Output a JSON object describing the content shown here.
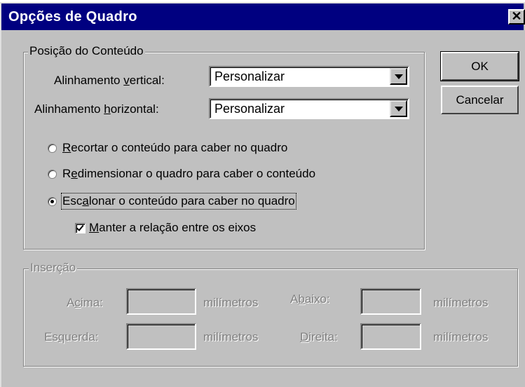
{
  "window": {
    "title": "Opções de Quadro",
    "close_glyph": "✕"
  },
  "content_position": {
    "group_title": "Posição do Conteúdo",
    "vertical_align": {
      "label_pre": "Alinhamento ",
      "label_ul": "v",
      "label_post": "ertical:",
      "value": "Personalizar"
    },
    "horizontal_align": {
      "label_pre": "Alinhamento ",
      "label_ul": "h",
      "label_post": "orizontal:",
      "value": "Personalizar"
    },
    "options": [
      {
        "ul": "R",
        "text": "ecortar o conteúdo para caber no quadro",
        "selected": false
      },
      {
        "pre": "R",
        "ul": "e",
        "text": "dimensionar o quadro para caber o conteúdo",
        "selected": false
      },
      {
        "pre": "Esc",
        "ul": "a",
        "text": "lonar o conteúdo para caber no quadro",
        "selected": true
      }
    ],
    "keep_ratio": {
      "ul": "M",
      "text": "anter a relação entre os eixos",
      "checked": true
    }
  },
  "inset": {
    "group_title": "Inserção",
    "top": {
      "pre": "A",
      "ul": "c",
      "post": "ima:"
    },
    "bottom": {
      "pre": "A",
      "ul": "b",
      "post": "aixo:"
    },
    "left": {
      "pre": "Es",
      "ul": "q",
      "post": "uerda:"
    },
    "right": {
      "pre": "",
      "ul": "D",
      "post": "ireita:"
    },
    "unit": "milímetros"
  },
  "buttons": {
    "ok": "OK",
    "cancel": "Cancelar"
  }
}
